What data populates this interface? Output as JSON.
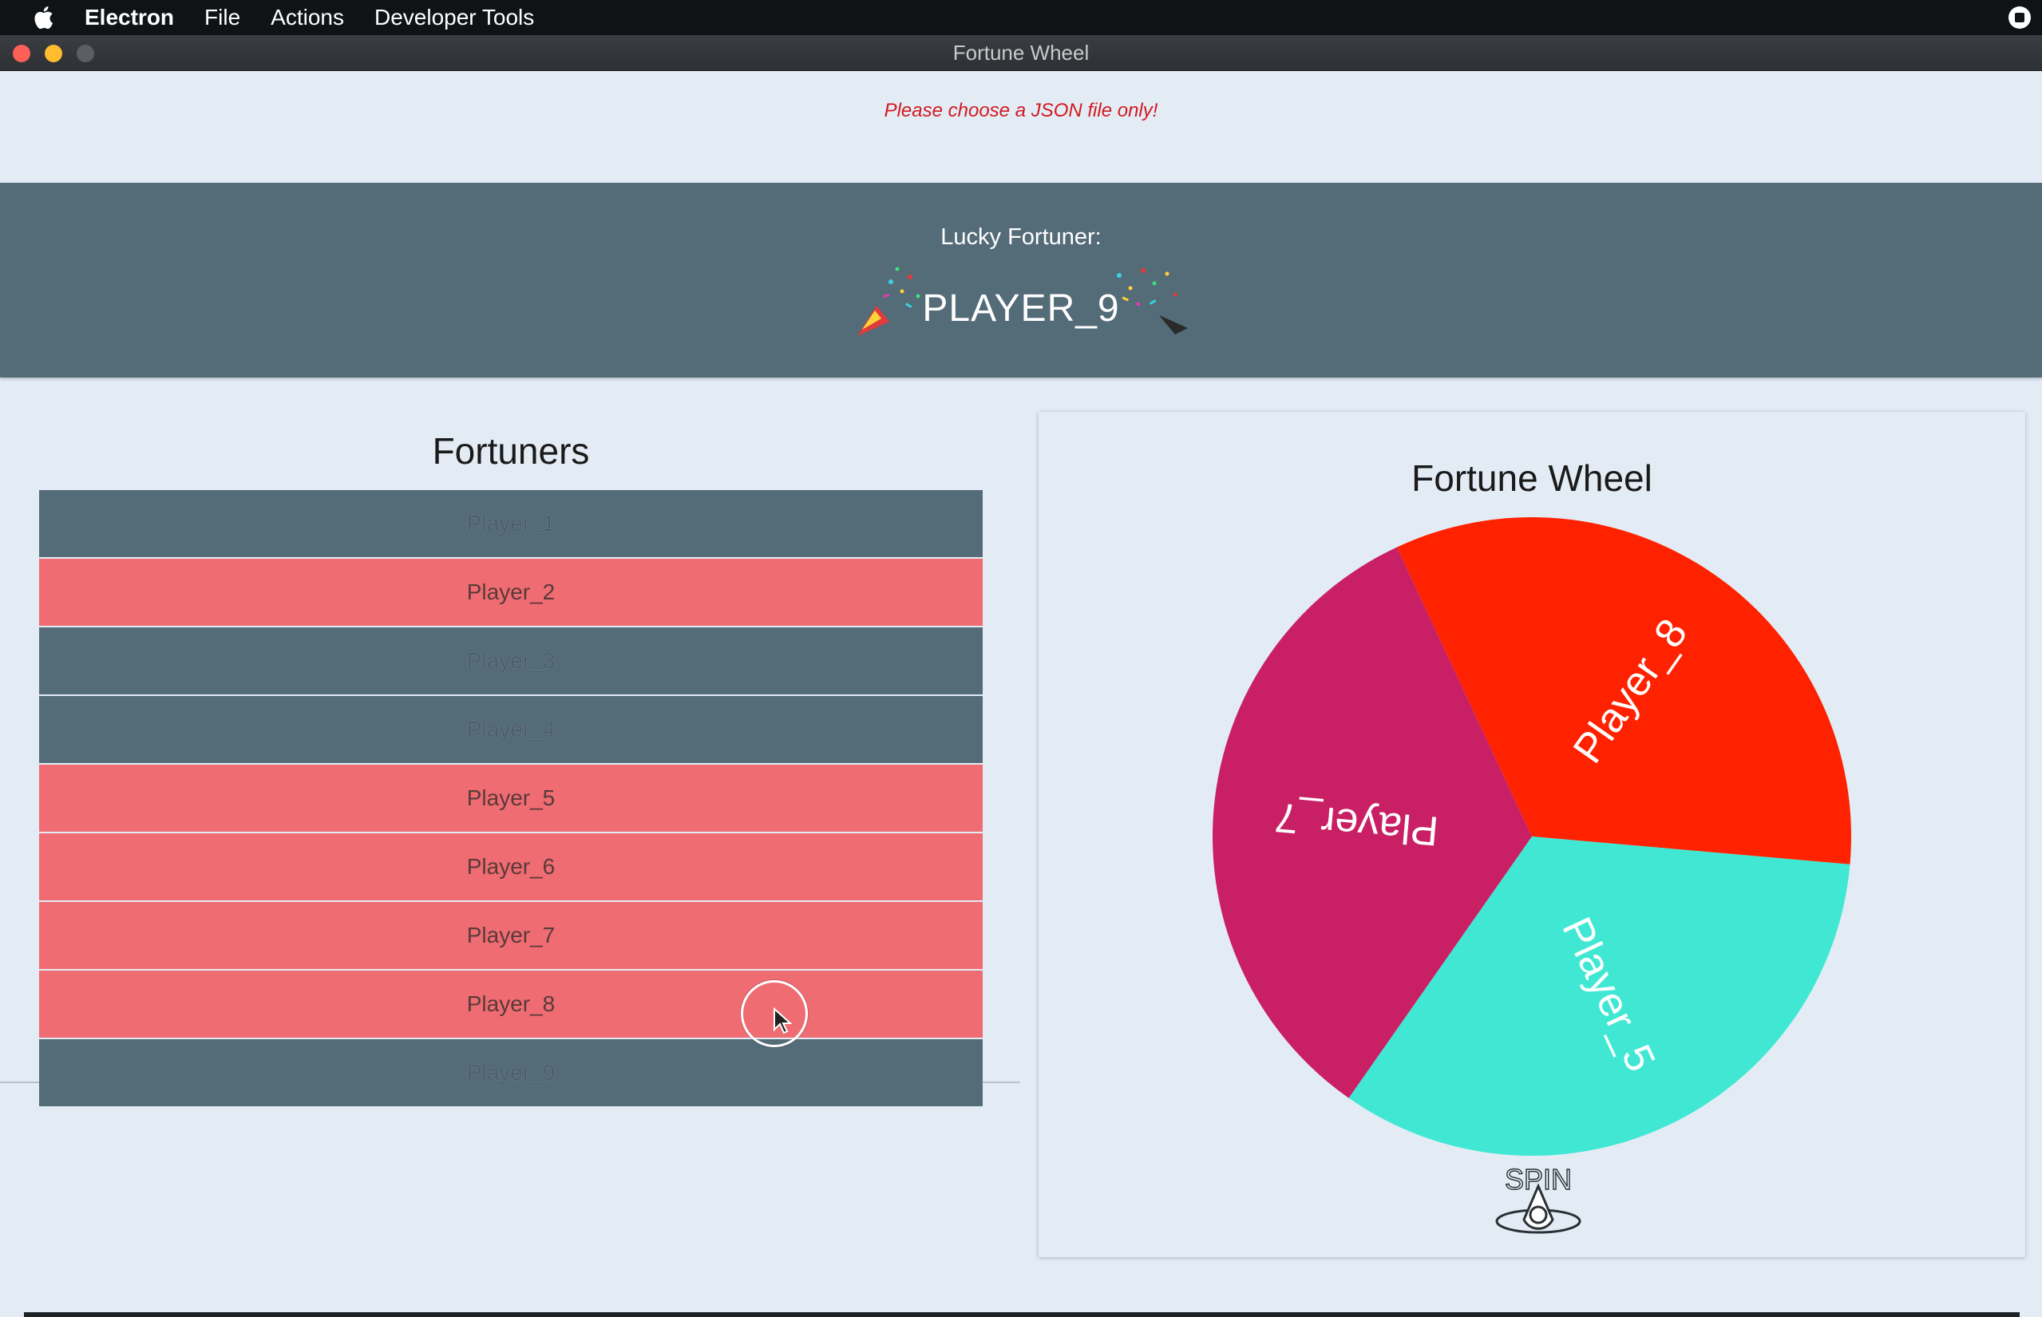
{
  "menubar": {
    "app_name": "Electron",
    "items": [
      "File",
      "Actions",
      "Developer Tools"
    ]
  },
  "window": {
    "title": "Fortune Wheel"
  },
  "error_message": "Please choose a JSON file only!",
  "winner": {
    "label": "Lucky Fortuner:",
    "name": "PLAYER_9"
  },
  "fortuners": {
    "title": "Fortuners",
    "players": [
      {
        "name": "Player_1",
        "state": "eliminated"
      },
      {
        "name": "Player_2",
        "state": "active"
      },
      {
        "name": "Player_3",
        "state": "eliminated"
      },
      {
        "name": "Player_4",
        "state": "eliminated"
      },
      {
        "name": "Player_5",
        "state": "active"
      },
      {
        "name": "Player_6",
        "state": "active"
      },
      {
        "name": "Player_7",
        "state": "active"
      },
      {
        "name": "Player_8",
        "state": "active"
      },
      {
        "name": "Player_9",
        "state": "eliminated"
      }
    ]
  },
  "wheel": {
    "title": "Fortune Wheel",
    "spin_label": "SPIN",
    "segments": [
      {
        "label": "Player_8",
        "color": "#ff2200"
      },
      {
        "label": "Player_5",
        "color": "#40e8d3"
      },
      {
        "label": "Player_7",
        "color": "#c92065"
      }
    ]
  },
  "colors": {
    "background": "#e3ecf5",
    "banner": "#546b78",
    "active_row": "#ee6c72",
    "eliminated_row": "#546b78",
    "error": "#d2191f"
  }
}
